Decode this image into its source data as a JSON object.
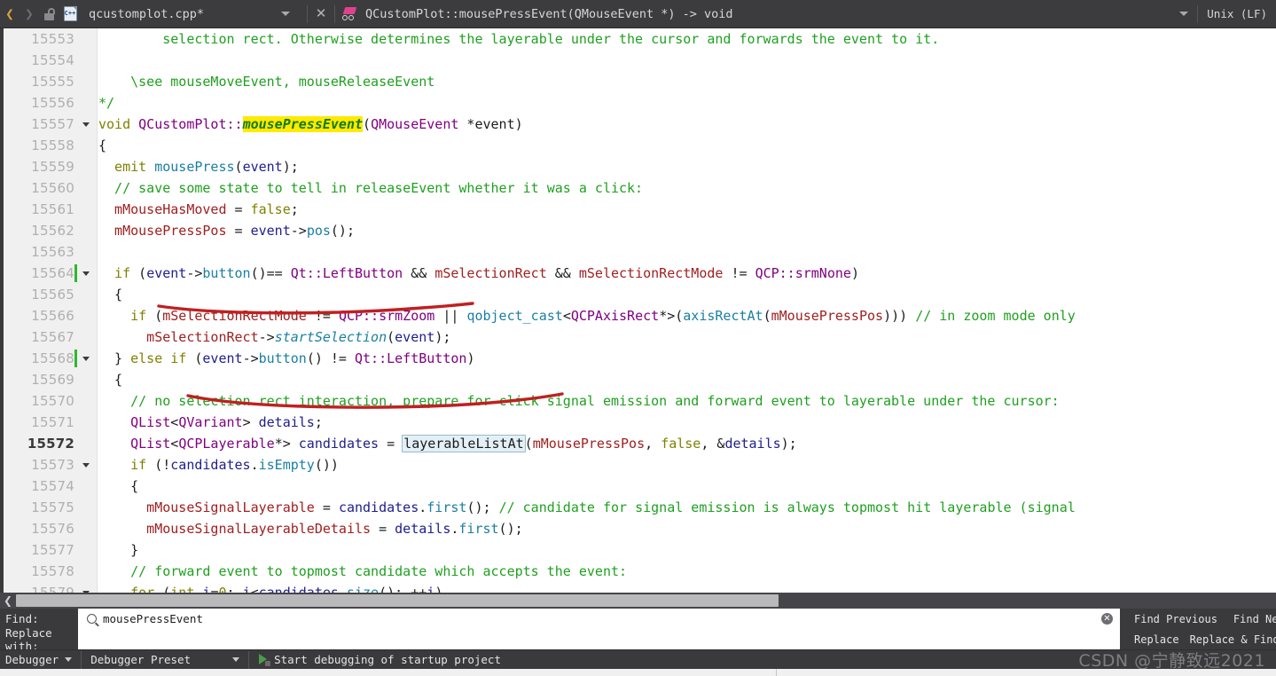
{
  "topbar": {
    "back_icon": "arrow-left-icon",
    "forward_icon": "arrow-right-icon",
    "lock_icon": "unlocked-padlock-icon",
    "file_icon_label": "C++",
    "tab_title": "qcustomplot.cpp*",
    "dropdown_icon": "chevron-down-icon",
    "close_icon": "close-icon",
    "symbol_icon": "class-symbol-icon",
    "symbol_title": "QCustomPlot::mousePressEvent(QMouseEvent *) -> void",
    "eol_dropdown_icon": "chevron-down-icon",
    "eol_label": "Unix (LF)"
  },
  "editor": {
    "current_line": 15572,
    "lines": [
      {
        "num": "15553",
        "fold": false,
        "changed": false,
        "tokens": [
          {
            "t": "        selection rect. Otherwise determines the layerable under the cursor and forwards the event to it.",
            "c": "t-cmt"
          }
        ]
      },
      {
        "num": "15554",
        "fold": false,
        "changed": false,
        "tokens": [
          {
            "t": "",
            "c": "t-cmt"
          }
        ]
      },
      {
        "num": "15555",
        "fold": false,
        "changed": false,
        "tokens": [
          {
            "t": "    \\see mouseMoveEvent, mouseReleaseEvent",
            "c": "t-cmt"
          }
        ]
      },
      {
        "num": "15556",
        "fold": false,
        "changed": false,
        "tokens": [
          {
            "t": "*/",
            "c": "t-cmt"
          }
        ]
      },
      {
        "num": "15557",
        "fold": true,
        "changed": false,
        "tokens": [
          {
            "t": "void ",
            "c": "t-kw"
          },
          {
            "t": "QCustomPlot",
            "c": "t-typ"
          },
          {
            "t": "::",
            "c": "t-typ"
          },
          {
            "t": "mousePressEvent",
            "c": "hl-yellow"
          },
          {
            "t": "(",
            "c": "t-pl"
          },
          {
            "t": "QMouseEvent",
            "c": "t-typ"
          },
          {
            "t": " *event)",
            "c": "t-pl"
          }
        ]
      },
      {
        "num": "15558",
        "fold": false,
        "changed": false,
        "tokens": [
          {
            "t": "{",
            "c": "t-pl"
          }
        ]
      },
      {
        "num": "15559",
        "fold": false,
        "changed": false,
        "tokens": [
          {
            "t": "  emit ",
            "c": "t-kw"
          },
          {
            "t": "mousePress",
            "c": "t-fn"
          },
          {
            "t": "(",
            "c": "t-pl"
          },
          {
            "t": "event",
            "c": "t-blu"
          },
          {
            "t": ");",
            "c": "t-pl"
          }
        ]
      },
      {
        "num": "15560",
        "fold": false,
        "changed": false,
        "tokens": [
          {
            "t": "  // save some state to tell in releaseEvent whether it was a click:",
            "c": "t-cmt"
          }
        ]
      },
      {
        "num": "15561",
        "fold": false,
        "changed": false,
        "tokens": [
          {
            "t": "  mMouseHasMoved",
            "c": "t-var"
          },
          {
            "t": " = ",
            "c": "t-pl"
          },
          {
            "t": "false",
            "c": "t-kw"
          },
          {
            "t": ";",
            "c": "t-pl"
          }
        ]
      },
      {
        "num": "15562",
        "fold": false,
        "changed": false,
        "tokens": [
          {
            "t": "  mMousePressPos",
            "c": "t-var"
          },
          {
            "t": " = ",
            "c": "t-pl"
          },
          {
            "t": "event",
            "c": "t-blu"
          },
          {
            "t": "->",
            "c": "t-pl"
          },
          {
            "t": "pos",
            "c": "t-fn"
          },
          {
            "t": "();",
            "c": "t-pl"
          }
        ]
      },
      {
        "num": "15563",
        "fold": false,
        "changed": false,
        "tokens": [
          {
            "t": "",
            "c": "t-pl"
          }
        ]
      },
      {
        "num": "15564",
        "fold": true,
        "changed": true,
        "tokens": [
          {
            "t": "  if ",
            "c": "t-kw"
          },
          {
            "t": "(",
            "c": "t-pl"
          },
          {
            "t": "event",
            "c": "t-blu"
          },
          {
            "t": "->",
            "c": "t-pl"
          },
          {
            "t": "button",
            "c": "t-fn"
          },
          {
            "t": "()== ",
            "c": "t-pl"
          },
          {
            "t": "Qt::LeftButton",
            "c": "t-typ"
          },
          {
            "t": " && ",
            "c": "t-pl"
          },
          {
            "t": "mSelectionRect",
            "c": "t-var"
          },
          {
            "t": " && ",
            "c": "t-pl"
          },
          {
            "t": "mSelectionRectMode",
            "c": "t-var"
          },
          {
            "t": " != ",
            "c": "t-pl"
          },
          {
            "t": "QCP::srmNone",
            "c": "t-typ"
          },
          {
            "t": ")",
            "c": "t-pl"
          }
        ]
      },
      {
        "num": "15565",
        "fold": false,
        "changed": false,
        "tokens": [
          {
            "t": "  {",
            "c": "t-pl"
          }
        ]
      },
      {
        "num": "15566",
        "fold": false,
        "changed": false,
        "tokens": [
          {
            "t": "    if ",
            "c": "t-kw"
          },
          {
            "t": "(",
            "c": "t-pl"
          },
          {
            "t": "mSelectionRectMode",
            "c": "t-var"
          },
          {
            "t": " != ",
            "c": "t-pl"
          },
          {
            "t": "QCP::srmZoom",
            "c": "t-typ"
          },
          {
            "t": " || ",
            "c": "t-pl"
          },
          {
            "t": "qobject_cast",
            "c": "t-fn"
          },
          {
            "t": "<",
            "c": "t-pl"
          },
          {
            "t": "QCPAxisRect",
            "c": "t-typ"
          },
          {
            "t": "*>(",
            "c": "t-pl"
          },
          {
            "t": "axisRectAt",
            "c": "t-fn"
          },
          {
            "t": "(",
            "c": "t-pl"
          },
          {
            "t": "mMousePressPos",
            "c": "t-var"
          },
          {
            "t": "))) ",
            "c": "t-pl"
          },
          {
            "t": "// in zoom mode only ",
            "c": "t-cmt"
          }
        ]
      },
      {
        "num": "15567",
        "fold": false,
        "changed": false,
        "tokens": [
          {
            "t": "      mSelectionRect",
            "c": "t-var"
          },
          {
            "t": "->",
            "c": "t-pl"
          },
          {
            "t": "startSelection",
            "c": "it-fn"
          },
          {
            "t": "(",
            "c": "t-pl"
          },
          {
            "t": "event",
            "c": "t-blu"
          },
          {
            "t": ");",
            "c": "t-pl"
          }
        ]
      },
      {
        "num": "15568",
        "fold": true,
        "changed": true,
        "tokens": [
          {
            "t": "  } ",
            "c": "t-pl"
          },
          {
            "t": "else if ",
            "c": "t-kw"
          },
          {
            "t": "(",
            "c": "t-pl"
          },
          {
            "t": "event",
            "c": "t-blu"
          },
          {
            "t": "->",
            "c": "t-pl"
          },
          {
            "t": "button",
            "c": "t-fn"
          },
          {
            "t": "() != ",
            "c": "t-pl"
          },
          {
            "t": "Qt::LeftButton",
            "c": "t-typ"
          },
          {
            "t": ")",
            "c": "t-pl"
          }
        ]
      },
      {
        "num": "15569",
        "fold": false,
        "changed": false,
        "tokens": [
          {
            "t": "  {",
            "c": "t-pl"
          }
        ]
      },
      {
        "num": "15570",
        "fold": false,
        "changed": false,
        "tokens": [
          {
            "t": "    // no selection rect interaction, prepare for click signal emission and forward event to layerable under the cursor:",
            "c": "t-cmt"
          }
        ]
      },
      {
        "num": "15571",
        "fold": false,
        "changed": false,
        "tokens": [
          {
            "t": "    QList",
            "c": "t-typ"
          },
          {
            "t": "<",
            "c": "t-pl"
          },
          {
            "t": "QVariant",
            "c": "t-typ"
          },
          {
            "t": "> ",
            "c": "t-pl"
          },
          {
            "t": "details",
            "c": "t-blu"
          },
          {
            "t": ";",
            "c": "t-pl"
          }
        ]
      },
      {
        "num": "15572",
        "fold": false,
        "changed": false,
        "current": true,
        "tokens": [
          {
            "t": "    QList",
            "c": "t-typ"
          },
          {
            "t": "<",
            "c": "t-pl"
          },
          {
            "t": "QCPLayerable",
            "c": "t-typ"
          },
          {
            "t": "*> ",
            "c": "t-pl"
          },
          {
            "t": "candidates",
            "c": "t-blu"
          },
          {
            "t": " = ",
            "c": "t-pl"
          },
          {
            "t": "layerableListAt",
            "c": "occ-box"
          },
          {
            "t": "(",
            "c": "t-pl"
          },
          {
            "t": "mMousePressPos",
            "c": "t-var"
          },
          {
            "t": ", ",
            "c": "t-pl"
          },
          {
            "t": "false",
            "c": "t-kw"
          },
          {
            "t": ", &",
            "c": "t-pl"
          },
          {
            "t": "details",
            "c": "t-blu"
          },
          {
            "t": ");",
            "c": "t-pl"
          }
        ]
      },
      {
        "num": "15573",
        "fold": true,
        "changed": false,
        "tokens": [
          {
            "t": "    if ",
            "c": "t-kw"
          },
          {
            "t": "(!",
            "c": "t-pl"
          },
          {
            "t": "candidates",
            "c": "t-blu"
          },
          {
            "t": ".",
            "c": "t-pl"
          },
          {
            "t": "isEmpty",
            "c": "t-fn"
          },
          {
            "t": "())",
            "c": "t-pl"
          }
        ]
      },
      {
        "num": "15574",
        "fold": false,
        "changed": false,
        "tokens": [
          {
            "t": "    {",
            "c": "t-pl"
          }
        ]
      },
      {
        "num": "15575",
        "fold": false,
        "changed": false,
        "tokens": [
          {
            "t": "      mMouseSignalLayerable",
            "c": "t-var"
          },
          {
            "t": " = ",
            "c": "t-pl"
          },
          {
            "t": "candidates",
            "c": "t-blu"
          },
          {
            "t": ".",
            "c": "t-pl"
          },
          {
            "t": "first",
            "c": "t-fn"
          },
          {
            "t": "(); ",
            "c": "t-pl"
          },
          {
            "t": "// candidate for signal emission is always topmost hit layerable (signal",
            "c": "t-cmt"
          }
        ]
      },
      {
        "num": "15576",
        "fold": false,
        "changed": false,
        "tokens": [
          {
            "t": "      mMouseSignalLayerableDetails",
            "c": "t-var"
          },
          {
            "t": " = ",
            "c": "t-pl"
          },
          {
            "t": "details",
            "c": "t-blu"
          },
          {
            "t": ".",
            "c": "t-pl"
          },
          {
            "t": "first",
            "c": "t-fn"
          },
          {
            "t": "();",
            "c": "t-pl"
          }
        ]
      },
      {
        "num": "15577",
        "fold": false,
        "changed": false,
        "tokens": [
          {
            "t": "    }",
            "c": "t-pl"
          }
        ]
      },
      {
        "num": "15578",
        "fold": false,
        "changed": false,
        "tokens": [
          {
            "t": "    // forward event to topmost candidate which accepts the event:",
            "c": "t-cmt"
          }
        ]
      },
      {
        "num": "15579",
        "fold": true,
        "changed": false,
        "tokens": [
          {
            "t": "    for ",
            "c": "t-kw"
          },
          {
            "t": "(",
            "c": "t-pl"
          },
          {
            "t": "int ",
            "c": "t-kw"
          },
          {
            "t": "i",
            "c": "t-blu"
          },
          {
            "t": "=",
            "c": "t-pl"
          },
          {
            "t": "0",
            "c": "t-num"
          },
          {
            "t": "; ",
            "c": "t-pl"
          },
          {
            "t": "i",
            "c": "t-blu"
          },
          {
            "t": "<",
            "c": "t-pl"
          },
          {
            "t": "candidates",
            "c": "t-blu"
          },
          {
            "t": ".",
            "c": "t-pl"
          },
          {
            "t": "size",
            "c": "t-fn"
          },
          {
            "t": "(); ++",
            "c": "t-pl"
          },
          {
            "t": "i",
            "c": "t-blu"
          },
          {
            "t": ")",
            "c": "t-pl"
          }
        ]
      }
    ],
    "annotations": {
      "color": "#c02020",
      "marks": [
        "underline-left-button-compare",
        "underline-not-left-button"
      ]
    }
  },
  "hscroll": {
    "left_arrow_icon": "chevron-left-icon",
    "thumb_name": "horizontal-scrollbar-thumb"
  },
  "find_panel": {
    "find_label": "Find:",
    "find_value": "mousePressEvent",
    "find_placeholder": "",
    "search_icon": "search-icon",
    "clear_icon": "clear-icon",
    "replace_label": "Replace with:",
    "replace_value": "",
    "replace_placeholder": "",
    "find_previous": "Find Previous",
    "find_next": "Find Next",
    "replace": "Replace",
    "replace_and_find": "Replace & Find"
  },
  "debug_bar": {
    "debugger_label": "Debugger",
    "preset_label": "Debugger Preset",
    "run_icon": "start-debugging-icon",
    "action_label": "Start debugging of startup project"
  },
  "watermark": {
    "text": "CSDN @宁静致远2021"
  }
}
